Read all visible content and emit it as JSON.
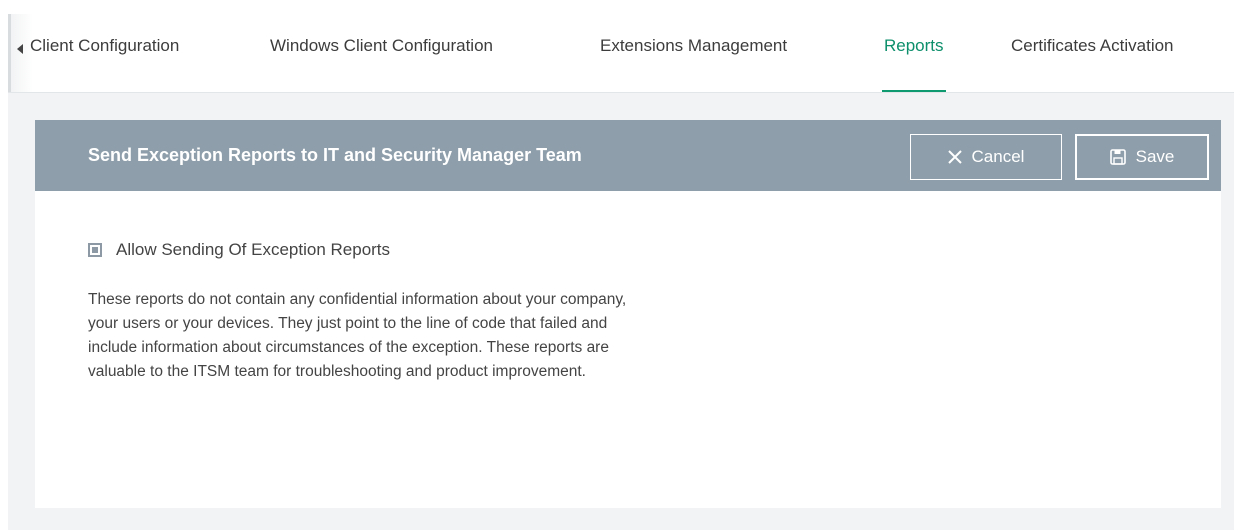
{
  "tabs": [
    {
      "label": "Client Configuration",
      "active": false
    },
    {
      "label": "Windows Client Configuration",
      "active": false
    },
    {
      "label": "Extensions Management",
      "active": false
    },
    {
      "label": "Reports",
      "active": true
    },
    {
      "label": "Certificates Activation",
      "active": false
    }
  ],
  "panel": {
    "title": "Send Exception Reports to IT and Security Manager Team",
    "cancel_label": "Cancel",
    "save_label": "Save"
  },
  "setting": {
    "checkbox_label": "Allow Sending Of Exception Reports",
    "checked": true,
    "description": "These reports do not contain any confidential information about your company, your users or your devices. They just point to the line of code that failed and include information about circumstances of the exception. These reports are valuable to the ITSM team for troubleshooting and product improvement."
  },
  "colors": {
    "accent": "#0f9b6f",
    "header_bg": "#8e9eaa"
  }
}
